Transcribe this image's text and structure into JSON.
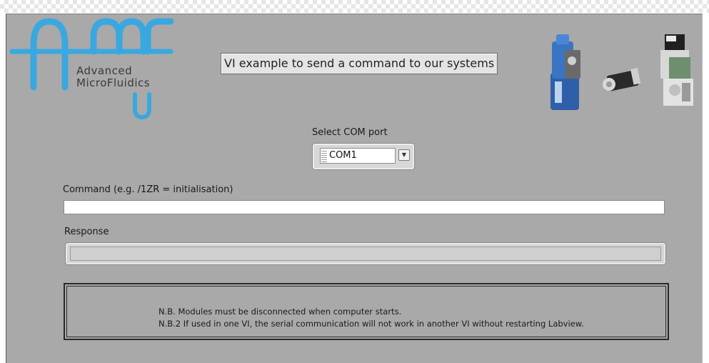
{
  "logo": {
    "line1": "Advanced",
    "line2": "MicroFluidics",
    "accent_color": "#3aa8e0"
  },
  "header": {
    "title": "VI example to send a command to our systems"
  },
  "products_image": {
    "icon": "pump-devices-image"
  },
  "com_port": {
    "label": "Select COM port",
    "value": "COM1"
  },
  "command": {
    "label": "Command (e.g. /1ZR = initialisation)",
    "value": ""
  },
  "response": {
    "label": "Response",
    "value": ""
  },
  "notes": {
    "line1": "N.B. Modules must be disconnected when computer starts.",
    "line2": "N.B.2 If used in one VI, the serial communication will not work in another VI without restarting Labview."
  }
}
